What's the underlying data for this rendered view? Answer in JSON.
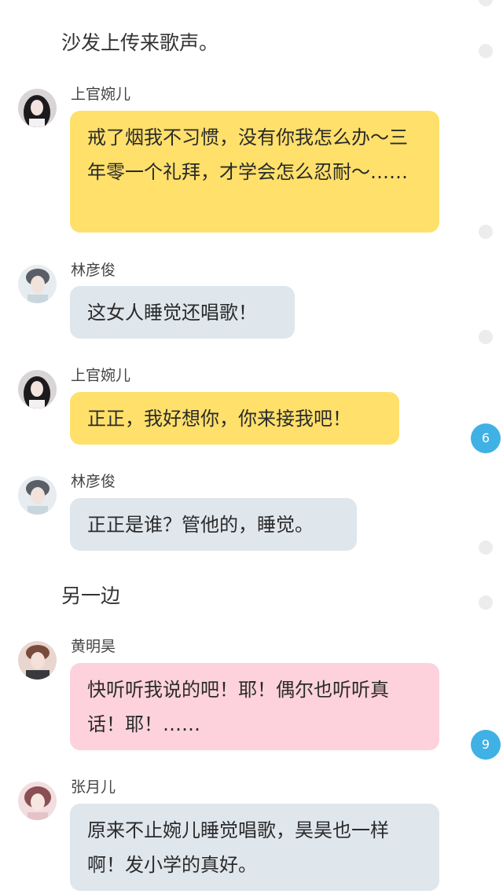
{
  "narration": [
    {
      "text": "沙发上传来歌声。"
    },
    {
      "text": "另一边"
    }
  ],
  "messages": [
    {
      "sender": "上官婉儿",
      "text": "戒了烟我不习惯，没有你我怎么办～三年零一个礼拜，才学会怎么忍耐～……",
      "bubble_color": "#fee06b"
    },
    {
      "sender": "林彦俊",
      "text": "这女人睡觉还唱歌！",
      "bubble_color": "#dfe6ec"
    },
    {
      "sender": "上官婉儿",
      "text": "正正，我好想你，你来接我吧！",
      "bubble_color": "#fee06b"
    },
    {
      "sender": "林彦俊",
      "text": "正正是谁？管他的，睡觉。",
      "bubble_color": "#dfe6ec"
    },
    {
      "sender": "黄明昊",
      "text": "快听听我说的吧！耶！偶尔也听听真话！耶！……",
      "bubble_color": "#fdd2dc"
    },
    {
      "sender": "张月儿",
      "text": "原来不止婉儿睡觉唱歌，昊昊也一样啊！发小学的真好。",
      "bubble_color": "#dfe6ec"
    }
  ],
  "comment_badges": [
    {
      "count": "6"
    },
    {
      "count": "9"
    }
  ]
}
